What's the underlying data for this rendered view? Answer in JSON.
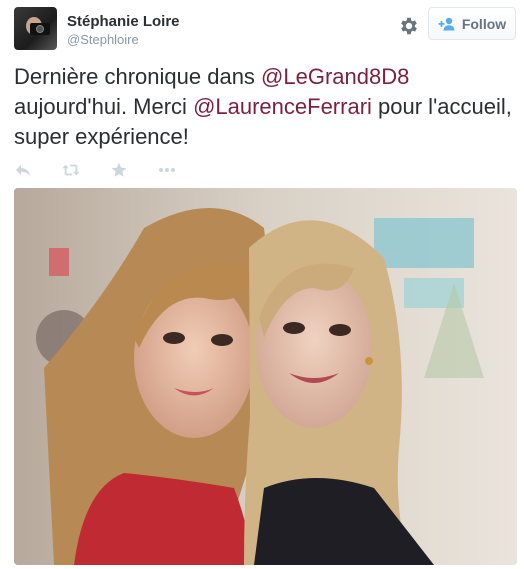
{
  "author": {
    "name": "Stéphanie Loire",
    "handle": "@Stephloire"
  },
  "follow_button": {
    "label": "Follow"
  },
  "tweet": {
    "parts": [
      {
        "text": "Dernière chronique dans ",
        "type": "text"
      },
      {
        "text": "@LeGrand8D8",
        "type": "mention"
      },
      {
        "text": " aujourd'hui. Merci ",
        "type": "text"
      },
      {
        "text": "@LaurenceFerrari",
        "type": "mention"
      },
      {
        "text": " pour l'accueil, super expérience!",
        "type": "text"
      }
    ]
  },
  "actions": {
    "icons": [
      "reply-icon",
      "retweet-icon",
      "favorite-icon",
      "more-icon"
    ]
  },
  "colors": {
    "mention": "#7e1f3c",
    "secondary": "#8899a6",
    "action_icon": "#ccd6dd"
  },
  "media": {
    "icon": "photo"
  }
}
